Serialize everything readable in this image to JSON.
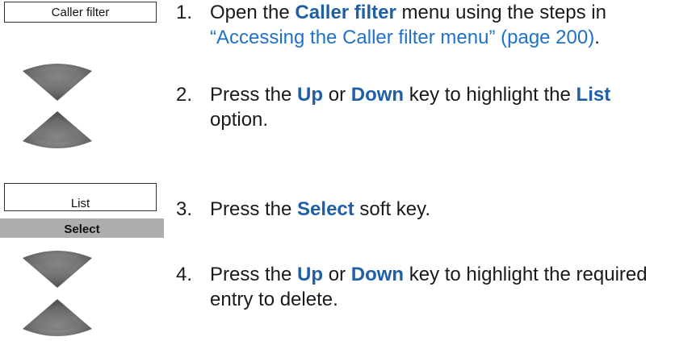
{
  "screens": {
    "caller_filter": "Caller filter",
    "list": "List"
  },
  "softkeys": {
    "select": "Select"
  },
  "icons": {
    "nav_up": "navigation-up-key-icon",
    "nav_down": "navigation-down-key-icon"
  },
  "colors": {
    "keyword": "#1f5fa8",
    "link": "#1f72c8",
    "softkey_bg": "#aeaeae"
  },
  "steps": [
    {
      "number": "1.",
      "t1": "Open the ",
      "k1": "Caller filter",
      "t2": " menu using the steps in",
      "link": "“Accessing the Caller filter menu” (page 200)",
      "t3": "."
    },
    {
      "number": "2.",
      "t1": "Press the ",
      "k1": "Up",
      "t2": " or ",
      "k2": "Down",
      "t3": " key to highlight the ",
      "k3": "List",
      "t4": "option."
    },
    {
      "number": "3.",
      "t1": "Press the ",
      "k1": "Select",
      "t2": " soft key."
    },
    {
      "number": "4.",
      "t1": "Press the ",
      "k1": "Up",
      "t2": " or ",
      "k2": "Down",
      "t3": " key to highlight the required",
      "t4": "entry to delete."
    }
  ]
}
